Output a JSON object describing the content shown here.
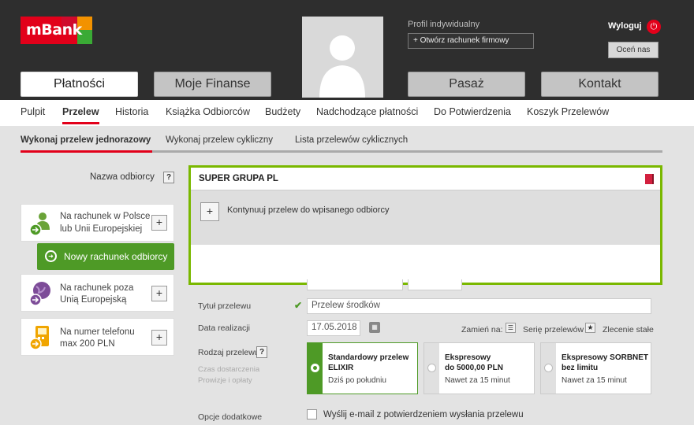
{
  "brand": {
    "logo_text": "mBank",
    "accent": "#e2001a",
    "success": "#4e9a26",
    "highlight": "#7ab800"
  },
  "header": {
    "profile_label": "Profil indywidualny",
    "open_account_label": "+ Otwórz rachunek firmowy",
    "logout_label": "Wyloguj",
    "rate_label": "Oceń nas",
    "nav": [
      "Płatności",
      "Moje Finanse",
      "Pasaż",
      "Kontakt"
    ],
    "active_nav": "Płatności"
  },
  "subnav": {
    "items": [
      "Pulpit",
      "Przelew",
      "Historia",
      "Książka Odbiorców",
      "Budżety",
      "Nadchodzące płatności",
      "Do Potwierdzenia",
      "Koszyk Przelewów"
    ],
    "active": "Przelew"
  },
  "tabs": {
    "items": [
      "Wykonaj przelew jednorazowy",
      "Wykonaj przelew cykliczny",
      "Lista przelewów cyklicznych"
    ],
    "active": "Wykonaj przelew jednorazowy"
  },
  "left": {
    "cards": [
      {
        "line1": "Na rachunek w Polsce",
        "line2": "lub Unii Europejskiej",
        "icon": "person-transfer-icon"
      },
      {
        "line1": "Na rachunek poza",
        "line2": "Unią Europejską",
        "icon": "globe-transfer-icon"
      },
      {
        "line1": "Na numer telefonu",
        "line2": "max 200 PLN",
        "icon": "phone-transfer-icon"
      }
    ],
    "new_account_label": "Nowy rachunek odbiorcy"
  },
  "form": {
    "recipient_label": "Nazwa odbiorcy",
    "help": "?",
    "recipient_value": "SUPER GRUPA PL",
    "suggestion_label": "Kontynuuj przelew do wpisanego odbiorcy",
    "title_label": "Tytuł przelewu",
    "title_value": "Przelew środków",
    "date_label": "Data realizacji",
    "date_value": "17.05.2018",
    "change_to_label": "Zamień na:",
    "series_label": "Serię przelewów",
    "standing_order_label": "Zlecenie stałe",
    "type_label": "Rodzaj przelewu",
    "delivery_label": "Czas dostarczenia",
    "fees_label": "Prowizje i opłaty",
    "options": [
      {
        "title1": "Standardowy przelew",
        "title2": "ELIXIR",
        "sub": "Dziś po południu",
        "selected": true
      },
      {
        "title1": "Ekspresowy",
        "title2": "do 5000,00 PLN",
        "sub": "Nawet za 15 minut",
        "selected": false
      },
      {
        "title1": "Ekspresowy SORBNET",
        "title2": "bez limitu",
        "sub": "Nawet za 15 minut",
        "selected": false
      }
    ],
    "extra_label": "Opcje dodatkowe",
    "email_label": "Wyślij e-mail z potwierdzeniem wysłania przelewu"
  }
}
